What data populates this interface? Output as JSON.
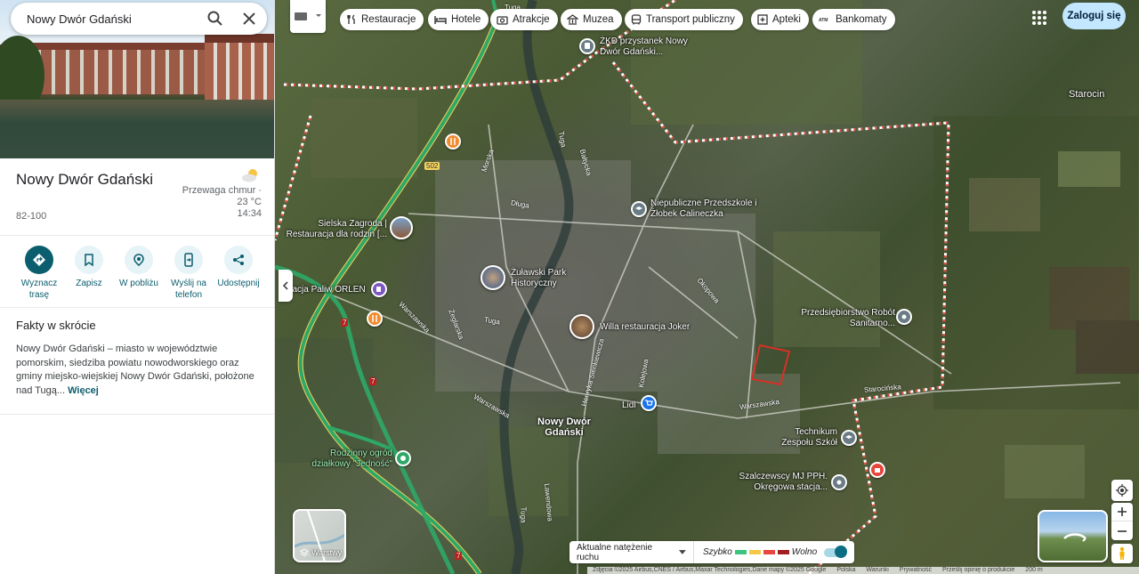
{
  "search": {
    "value": "Nowy Dwór Gdański"
  },
  "place": {
    "title": "Nowy Dwór Gdański",
    "postal_code": "82-100",
    "weather": {
      "condition": "Przewaga chmur ·",
      "temperature": "23 °C",
      "time": "14:34",
      "icon": "partly-cloudy-icon"
    }
  },
  "actions": [
    {
      "label": "Wyznacz trasę",
      "icon": "directions-icon"
    },
    {
      "label": "Zapisz",
      "icon": "bookmark-icon"
    },
    {
      "label": "W pobliżu",
      "icon": "nearby-icon"
    },
    {
      "label": "Wyślij na telefon",
      "icon": "send-to-phone-icon"
    },
    {
      "label": "Udostępnij",
      "icon": "share-icon"
    }
  ],
  "facts": {
    "title": "Fakty w skrócie",
    "text": "Nowy Dwór Gdański – miasto w województwie pomorskim, siedziba powiatu nowodworskiego oraz gminy miejsko-wiejskiej Nowy Dwór Gdański, położone nad Tugą...",
    "more": "Więcej"
  },
  "chips": [
    {
      "label": "Restauracje",
      "icon": "fork-knife-icon"
    },
    {
      "label": "Hotele",
      "icon": "bed-icon"
    },
    {
      "label": "Atrakcje",
      "icon": "camera-icon"
    },
    {
      "label": "Muzea",
      "icon": "museum-icon"
    },
    {
      "label": "Transport publiczny",
      "icon": "bus-icon"
    },
    {
      "label": "Apteki",
      "icon": "pharmacy-icon"
    },
    {
      "label": "Bankomaty",
      "icon": "atm-icon"
    }
  ],
  "signin": "Zaloguj się",
  "map_labels": {
    "zkd": "ŻKD przystanek Nowy Dwór Gdański...",
    "starocin": "Starocin",
    "przedszkole": "Niepubliczne Przedszkole i Żłobek Calineczka",
    "sielska": "Sielska Zagroda | Restauracja dla rodzin [...",
    "zulawski": "Żuławski Park Historyczny",
    "orlen": "Stacja Paliw ORLEN",
    "willa": "Willa restauracja Joker",
    "robot": "Przedsiębiorstwo Robót Sanitarno...",
    "lidl": "Lidl",
    "nowy_dwor": "Nowy Dwór Gdański",
    "technikum": "Technikum Zespołu Szkół",
    "ogrod": "Rodzinny ogród działkowy \"Jedność\"",
    "szalczewscy": "Szalczewscy MJ PPH. Okręgowa stacja..."
  },
  "street_labels": {
    "tuga1": "Tuga",
    "tuga2": "Tuga",
    "tuga3": "Tuga",
    "tuga4": "Tuga",
    "dluga": "Długa",
    "morska": "Morska",
    "baltycka": "Bałtycka",
    "okopowa": "Okopowa",
    "warszawska1": "Warszawska",
    "warszawska2": "Warszawska",
    "warszawska3": "Warszawska",
    "starocinska": "Starocińska",
    "kolejowa": "Kolejowa",
    "henryka": "Henryka Sienkiewicza",
    "zeglarska": "Żeglarska",
    "lawendowa": "Lawendowa",
    "road502": "502",
    "road7a": "7",
    "road7b": "7",
    "road7c": "7"
  },
  "layers_label": "Warstwy",
  "traffic": {
    "select": "Aktualne natężenie ruchu",
    "fast": "Szybko",
    "slow": "Wolno",
    "colors": [
      "#3ac47d",
      "#f7c845",
      "#e8453c",
      "#a11f1f"
    ]
  },
  "footer": {
    "imagery": "Zdjęcia ©2025 Airbus,CNES / Airbus,Maxar Technologies,Dane mapy ©2025 Google",
    "country": "Polska",
    "terms": "Warunki",
    "privacy": "Prywatność",
    "feedback": "Prześlij opinię o produkcie",
    "scale": "200 m"
  }
}
